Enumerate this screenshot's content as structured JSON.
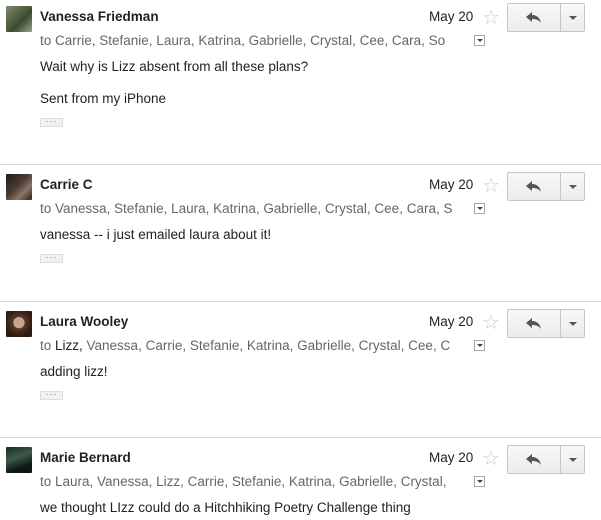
{
  "messages": [
    {
      "sender": "Vanessa Friedman",
      "date": "May 20",
      "recipients_first": "Carrie, Stefanie, Laura, Katrina, Gabrielle, Crystal, Cee, Cara, So",
      "recipients_rest": "",
      "to_label": "to",
      "body": [
        "Wait why is Lizz absent from all these plans?",
        "Sent from my iPhone"
      ],
      "ellipsis": "···"
    },
    {
      "sender": "Carrie C",
      "date": "May 20",
      "recipients_first": "Vanessa, Stefanie, Laura, Katrina, Gabrielle, Crystal, Cee, Cara, S",
      "recipients_rest": "",
      "to_label": "to",
      "body": [
        "vanessa -- i just emailed laura about it!"
      ],
      "ellipsis": "···"
    },
    {
      "sender": "Laura Wooley",
      "date": "May 20",
      "recipients_first": "Lizz,",
      "recipients_rest": " Vanessa, Carrie, Stefanie, Katrina, Gabrielle, Crystal, Cee, C",
      "to_label": "to",
      "body": [
        "adding lizz!"
      ],
      "ellipsis": "···"
    },
    {
      "sender": "Marie Bernard",
      "date": "May 20",
      "recipients_first": "Laura, Vanessa, Lizz, Carrie, Stefanie, Katrina, Gabrielle, Crystal,",
      "recipients_rest": "",
      "to_label": "to",
      "body": [
        "we thought LIzz could do a Hitchhiking Poetry Challenge thing"
      ],
      "ellipsis": ""
    }
  ],
  "icons": {
    "star": "star-outline-icon",
    "reply": "reply-arrow-icon",
    "more": "chevron-down-icon",
    "recipients_dropdown": "details-dropdown-icon"
  },
  "colors": {
    "star": "#c8c8c8",
    "secondary_text": "#666666",
    "divider": "#d8d8d8"
  }
}
